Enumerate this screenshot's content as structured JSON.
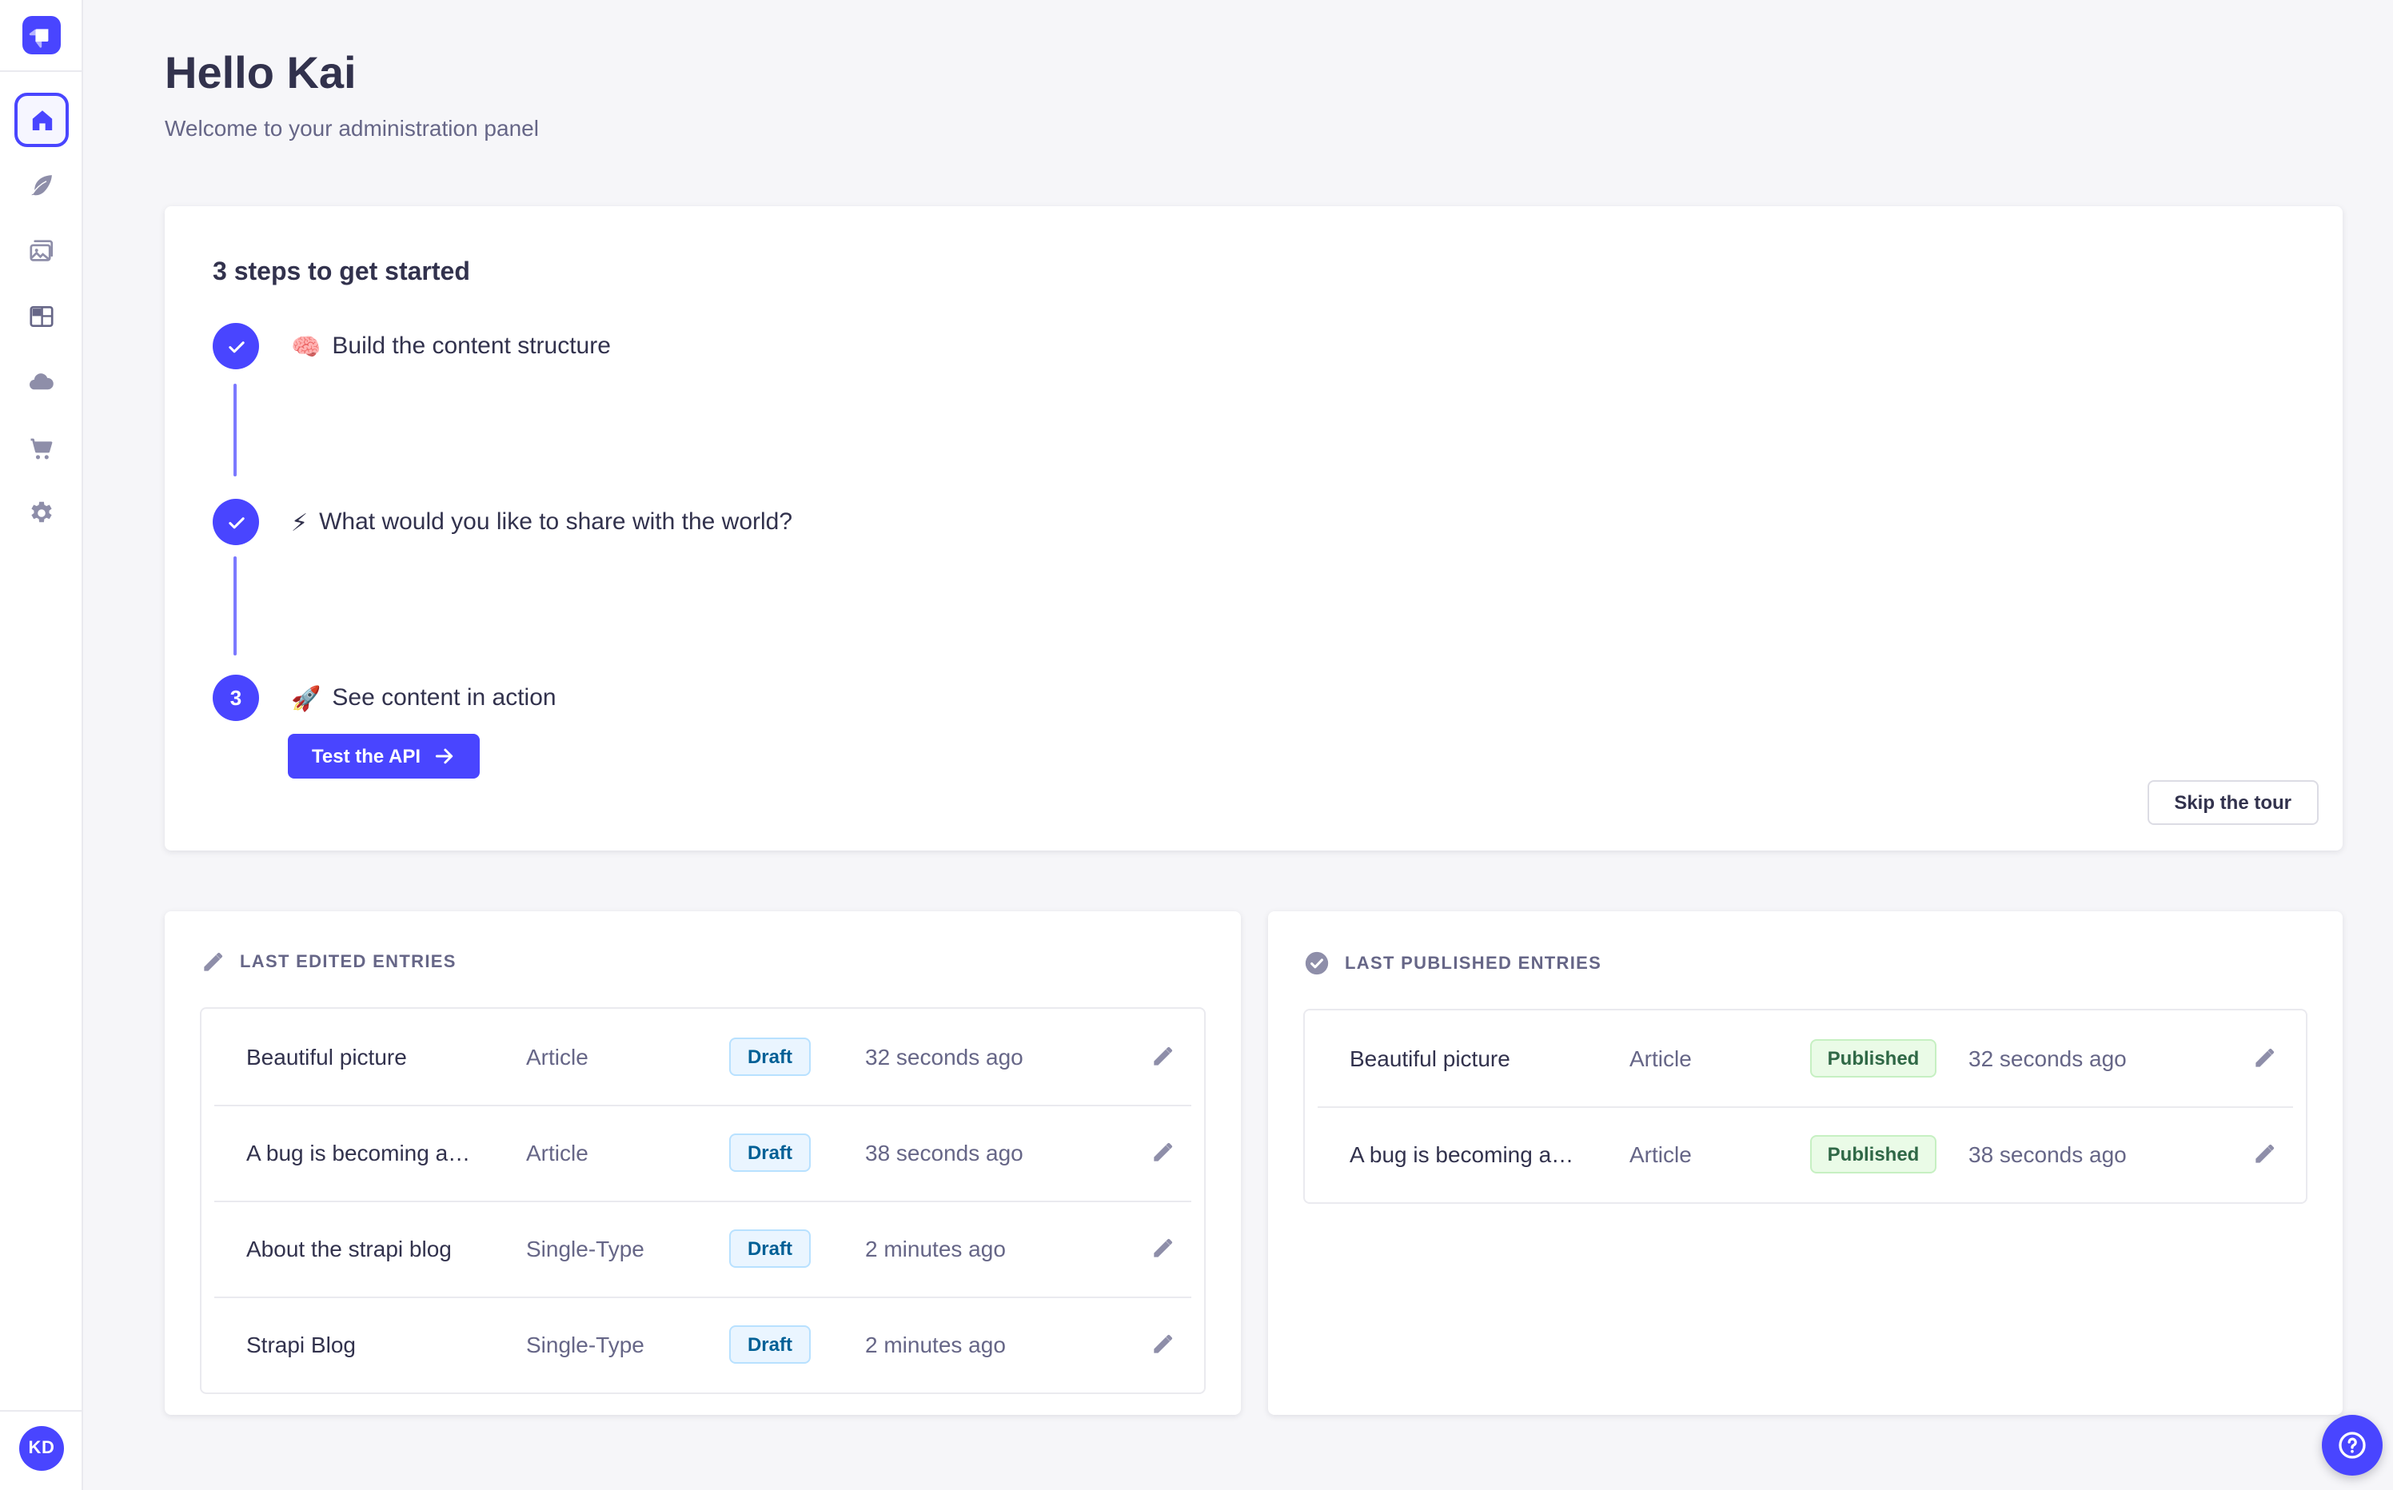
{
  "app": {
    "name": "Strapi administration panel"
  },
  "colors": {
    "primary": "#4945FF",
    "connector": "#7B79FF",
    "background": "#F6F6F9",
    "text_dark": "#32324D",
    "text_muted": "#666687",
    "icon_gray": "#8E8EA9",
    "border": "#EAEAEF",
    "draft_bg": "#EAF5FF",
    "draft_border": "#B8E1FF",
    "draft_text": "#006096",
    "published_bg": "#EAFBE7",
    "published_border": "#C6F0C2",
    "published_text": "#2F6846"
  },
  "sidebar": {
    "logo_icon": "strapi-logo",
    "items": [
      {
        "id": "home",
        "icon": "home-icon",
        "active": true
      },
      {
        "id": "content-manager",
        "icon": "feather-icon",
        "active": false
      },
      {
        "id": "media-library",
        "icon": "images-icon",
        "active": false
      },
      {
        "id": "content-type-builder",
        "icon": "layout-icon",
        "active": false
      },
      {
        "id": "cloud",
        "icon": "cloud-icon",
        "active": false
      },
      {
        "id": "marketplace",
        "icon": "cart-icon",
        "active": false
      },
      {
        "id": "settings",
        "icon": "gear-icon",
        "active": false
      }
    ],
    "avatar_initials": "KD"
  },
  "header": {
    "title": "Hello Kai",
    "subtitle": "Welcome to your administration panel"
  },
  "guided_tour": {
    "title": "3 steps to get started",
    "steps": [
      {
        "number": 1,
        "emoji": "🧠",
        "label": "Build the content structure",
        "status": "done"
      },
      {
        "number": 2,
        "emoji": "⚡",
        "label": "What would you like to share with the world?",
        "status": "done"
      },
      {
        "number": 3,
        "emoji": "🚀",
        "label": "See content in action",
        "status": "current",
        "cta": "Test the API"
      }
    ],
    "skip_label": "Skip the tour"
  },
  "last_edited": {
    "title": "LAST EDITED ENTRIES",
    "header_icon": "pencil-icon",
    "rows": [
      {
        "title": "Beautiful picture",
        "type": "Article",
        "status": "Draft",
        "time": "32 seconds ago"
      },
      {
        "title": "A bug is becoming a…",
        "type": "Article",
        "status": "Draft",
        "time": "38 seconds ago"
      },
      {
        "title": "About the strapi blog",
        "type": "Single-Type",
        "status": "Draft",
        "time": "2 minutes ago"
      },
      {
        "title": "Strapi Blog",
        "type": "Single-Type",
        "status": "Draft",
        "time": "2 minutes ago"
      }
    ]
  },
  "last_published": {
    "title": "LAST PUBLISHED ENTRIES",
    "header_icon": "check-circle-icon",
    "rows": [
      {
        "title": "Beautiful picture",
        "type": "Article",
        "status": "Published",
        "time": "32 seconds ago"
      },
      {
        "title": "A bug is becoming a…",
        "type": "Article",
        "status": "Published",
        "time": "38 seconds ago"
      }
    ]
  },
  "help": {
    "icon": "question-icon"
  }
}
